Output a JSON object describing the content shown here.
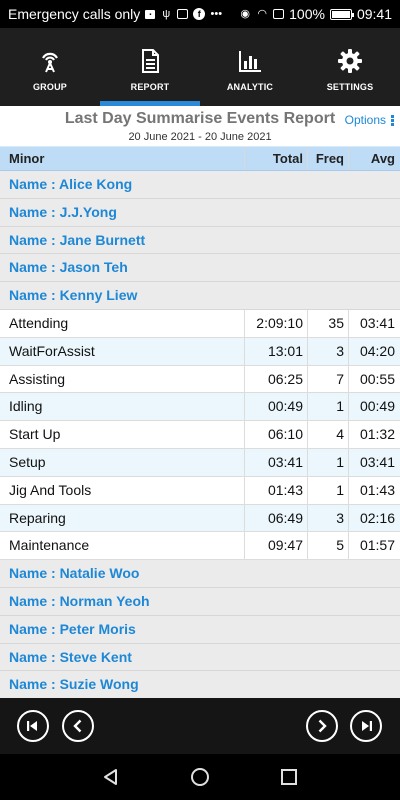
{
  "status_bar": {
    "left_text": "Emergency calls only",
    "battery": "100%",
    "time": "09:41",
    "icons": [
      "sim-icon",
      "usb-icon",
      "gallery-icon",
      "facebook-icon",
      "ellipsis-icon",
      "eye-icon",
      "wifi-icon",
      "data-icon"
    ]
  },
  "nav": {
    "tabs": [
      {
        "label": "GROUP",
        "icon": "broadcast-icon",
        "active": false
      },
      {
        "label": "REPORT",
        "icon": "document-icon",
        "active": true
      },
      {
        "label": "ANALYTIC",
        "icon": "bar-chart-icon",
        "active": false
      },
      {
        "label": "SETTINGS",
        "icon": "gear-icon",
        "active": false
      }
    ],
    "accent": "#2b8ad8"
  },
  "report": {
    "title": "Last Day Summarise Events Report",
    "date_range": "20 June 2021 - 20 June 2021",
    "options_label": "Options"
  },
  "table": {
    "columns": [
      "Minor",
      "Total",
      "Freq",
      "Avg"
    ],
    "names_before": [
      "Name : Alice Kong",
      "Name : J.J.Yong",
      "Name : Jane Burnett",
      "Name : Jason Teh",
      "Name : Kenny Liew"
    ],
    "rows": [
      {
        "minor": "Attending",
        "total": "2:09:10",
        "freq": "35",
        "avg": "03:41"
      },
      {
        "minor": "WaitForAssist",
        "total": "13:01",
        "freq": "3",
        "avg": "04:20"
      },
      {
        "minor": "Assisting",
        "total": "06:25",
        "freq": "7",
        "avg": "00:55"
      },
      {
        "minor": "Idling",
        "total": "00:49",
        "freq": "1",
        "avg": "00:49"
      },
      {
        "minor": "Start Up",
        "total": "06:10",
        "freq": "4",
        "avg": "01:32"
      },
      {
        "minor": "Setup",
        "total": "03:41",
        "freq": "1",
        "avg": "03:41"
      },
      {
        "minor": "Jig And Tools",
        "total": "01:43",
        "freq": "1",
        "avg": "01:43"
      },
      {
        "minor": "Reparing",
        "total": "06:49",
        "freq": "3",
        "avg": "02:16"
      },
      {
        "minor": "Maintenance",
        "total": "09:47",
        "freq": "5",
        "avg": "01:57"
      }
    ],
    "names_after": [
      "Name : Natalie Woo",
      "Name : Norman Yeoh",
      "Name : Peter Moris",
      "Name : Steve Kent",
      "Name : Suzie Wong"
    ],
    "colors": {
      "name": "#1e88d6",
      "header": "#bfdcf7",
      "alt_row": "#ebf7fc"
    }
  },
  "pager": {
    "buttons": [
      "first-page-icon",
      "previous-page-icon",
      "next-page-icon",
      "last-page-icon"
    ]
  },
  "android_nav": {
    "buttons": [
      "back-icon",
      "home-icon",
      "recents-icon"
    ]
  }
}
